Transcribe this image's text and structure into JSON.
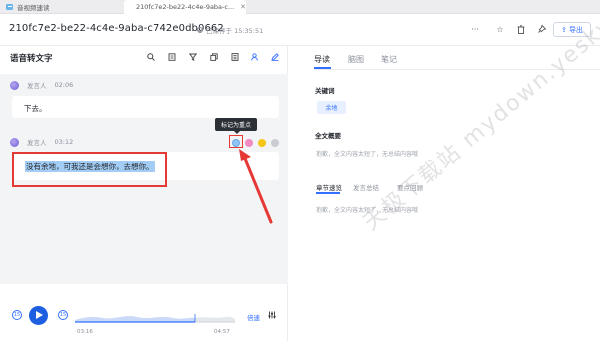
{
  "tabs": [
    {
      "label": "音视频速读"
    },
    {
      "label": "210fc7e2-be22-4c4e-9aba-c...",
      "close": "✕"
    }
  ],
  "header": {
    "title": "210fc7e2-be22-4c4e-9aba-c742e0db0662",
    "saved_status": "已保存于 15:35:51",
    "export_label": "导出"
  },
  "left": {
    "title": "语音转文字",
    "entries": [
      {
        "speaker": "发言人",
        "time": "02:06",
        "text": "下去。"
      },
      {
        "speaker": "发言人",
        "time": "03:12",
        "text": "没有余地，可我还是会想你，去想你。"
      }
    ],
    "tooltip": "标记为重点",
    "highlight_colors": [
      "#8fc4f5",
      "#f28ac4",
      "#f5c518",
      "#c9ccd1"
    ]
  },
  "player": {
    "current_time": "03:16",
    "total_time": "04:57",
    "progress": 0.66,
    "speed_label": "倍速",
    "rewind_label": "15",
    "forward_label": "15"
  },
  "right": {
    "tabs": [
      "导读",
      "脑图",
      "笔记"
    ],
    "keywords_label": "关键词",
    "keywords": [
      "余地"
    ],
    "summary_label": "全文概要",
    "summary_placeholder": "抱歉，全文内容太短了，无总结内容哦",
    "subtabs": [
      "章节速览",
      "发言总结",
      "要点回顾"
    ],
    "chapter_placeholder": "抱歉，全文内容太短了，无总结内容哦"
  },
  "watermark": "天极下载站 mydown.yesky.com",
  "colors": {
    "accent": "#3370ff",
    "annotation": "#e53935"
  }
}
